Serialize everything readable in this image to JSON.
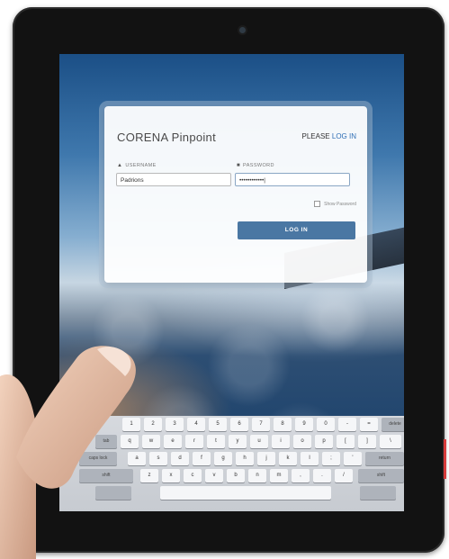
{
  "dialog": {
    "title_main": "CORENA",
    "title_sub": "Pinpoint",
    "prompt_text": "PLEASE",
    "prompt_link": "LOG IN",
    "username_label": "USERNAME",
    "password_label": "PASSWORD",
    "username_value": "Padrions",
    "password_value": "••••••••••••|",
    "show_password_label": "Show Password",
    "login_button": "LOG IN"
  },
  "keyboard": {
    "row0": [
      "1",
      "2",
      "3",
      "4",
      "5",
      "6",
      "7",
      "8",
      "9",
      "0",
      "-",
      "="
    ],
    "row0_right": "delete",
    "row1_left": "tab",
    "row1": [
      "q",
      "w",
      "e",
      "r",
      "t",
      "y",
      "u",
      "i",
      "o",
      "p",
      "[",
      "]",
      "\\"
    ],
    "row2_left": "caps lock",
    "row2": [
      "a",
      "s",
      "d",
      "f",
      "g",
      "h",
      "j",
      "k",
      "l",
      ";",
      "'"
    ],
    "row2_right": "return",
    "row3_left": "shift",
    "row3": [
      "z",
      "x",
      "c",
      "v",
      "b",
      "n",
      "m",
      ",",
      ".",
      "/"
    ],
    "row3_right": "shift"
  },
  "icons": {
    "user": "user-icon",
    "lock": "lock-icon"
  },
  "colors": {
    "login_button": "#4a77a3",
    "link": "#2f6fb5"
  }
}
